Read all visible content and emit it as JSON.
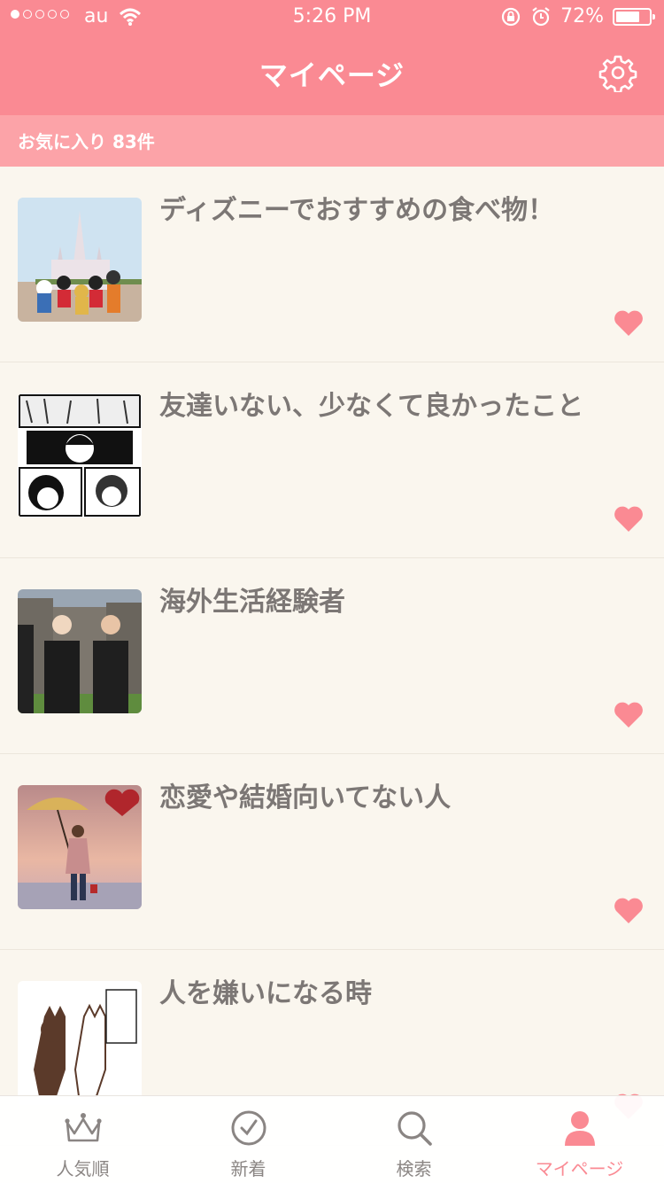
{
  "status_bar": {
    "carrier": "au",
    "time": "5:26 PM",
    "battery": "72%",
    "battery_level": 0.72
  },
  "header": {
    "title": "マイページ",
    "settings_icon": "gear-icon"
  },
  "favorites": {
    "label": "お気に入り 83件"
  },
  "items": [
    {
      "title": "ディズニーでおすすめの食べ物！"
    },
    {
      "title": "友達いない、少なくて良かったこと"
    },
    {
      "title": "海外生活経験者"
    },
    {
      "title": "恋愛や結婚向いてない人"
    },
    {
      "title": "人を嫌いになる時"
    }
  ],
  "tabs": [
    {
      "label": "人気順",
      "icon": "crown-icon"
    },
    {
      "label": "新着",
      "icon": "clock-icon"
    },
    {
      "label": "検索",
      "icon": "search-icon"
    },
    {
      "label": "マイページ",
      "icon": "person-icon",
      "active": true
    }
  ],
  "colors": {
    "accent": "#fa8a93",
    "subbar": "#fca3a8",
    "background": "#faf6ee",
    "title_text": "#7c7775"
  }
}
